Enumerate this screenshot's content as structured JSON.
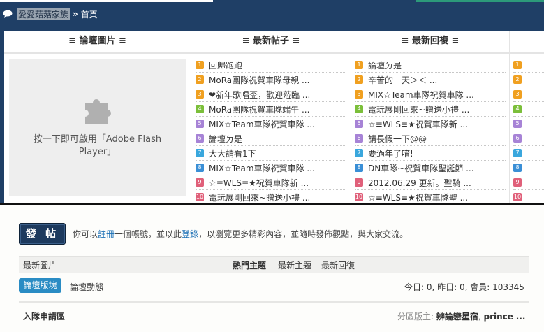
{
  "header": {
    "site_name": "愛愛菇菇家族",
    "separator": "»",
    "current": "首頁"
  },
  "columns": {
    "col1": "≡ 論壇圖片 ≡",
    "col2": "≡ 最新帖子 ≡",
    "col3": "≡ 最新回複 ≡"
  },
  "flash": {
    "message_line1": "按一下即可啟用「Adobe Flash",
    "message_line2": "Player」"
  },
  "latest_posts": [
    {
      "n": "1",
      "title": "回歸跑跑"
    },
    {
      "n": "2",
      "title": "MoRa團隊祝賀車隊母親 ..."
    },
    {
      "n": "3",
      "title": "❤新年歌唱盃，歡迎蒞臨 ..."
    },
    {
      "n": "4",
      "title": "MoRa團隊祝賀車隊端午 ..."
    },
    {
      "n": "5",
      "title": "MIX☆Team車隊祝賀車隊 ..."
    },
    {
      "n": "6",
      "title": "論壇ㄉ是"
    },
    {
      "n": "7",
      "title": "大大請看1下"
    },
    {
      "n": "8",
      "title": "MIX☆Team車隊祝賀車隊 ..."
    },
    {
      "n": "9",
      "title": "☆≡WLS≡★祝賀車隊新 ..."
    },
    {
      "n": "10",
      "title": "電玩展剛回來~贈送小禮 ..."
    }
  ],
  "latest_replies": [
    {
      "n": "1",
      "title": "論壇ㄉ是"
    },
    {
      "n": "2",
      "title": "辛苦的一天＞＜ ..."
    },
    {
      "n": "3",
      "title": "MIX☆Team車隊祝賀車隊 ..."
    },
    {
      "n": "4",
      "title": "電玩展剛回來~贈送小禮 ..."
    },
    {
      "n": "5",
      "title": "☆≡WLS≡★祝賀車隊新 ..."
    },
    {
      "n": "6",
      "title": "請長假一下@@"
    },
    {
      "n": "7",
      "title": "要過年了唷!"
    },
    {
      "n": "8",
      "title": "DN車隊~祝賀車隊聖誕節 ..."
    },
    {
      "n": "9",
      "title": "2012.06.29 更新。聖騎 ..."
    },
    {
      "n": "10",
      "title": "☆≡WLS≡★祝賀車隊聖 ..."
    }
  ],
  "fourth_col_numbers": [
    "1",
    "2",
    "3",
    "4",
    "5",
    "6",
    "7",
    "8",
    "9",
    "10"
  ],
  "colors": {
    "n1": "#f0a020",
    "n2": "#f0a020",
    "n3": "#f0a020",
    "n4": "#7bbf3a",
    "n5": "#a783d6",
    "n6": "#a783d6",
    "n7": "#3aa7dd",
    "n8": "#3a8fd6",
    "n9": "#e0607a",
    "n10": "#e0607a"
  },
  "post_bar": {
    "button_label": "發 帖",
    "text_before": "你可以",
    "register_link": "註冊",
    "text_mid": "一個帳號，並以此",
    "login_link": "登錄",
    "text_after": "，以瀏覽更多精彩內容，並隨時發佈觀點，與大家交流。"
  },
  "tabs": {
    "latest_images": "最新圖片",
    "hot_topics": "熱門主題",
    "new_topics": "最新主題",
    "new_replies": "最新回復"
  },
  "forum": {
    "button_label": "論壇版塊",
    "activity_label": "論壇動態",
    "stats_text": "今日: 0, 昨日: 0, 會員: 103345"
  },
  "section": {
    "title": "入隊申請區",
    "mods_label": "分區版主:",
    "mod1": "辨論戀星宿",
    "mod2": "prince",
    "more": "..."
  }
}
